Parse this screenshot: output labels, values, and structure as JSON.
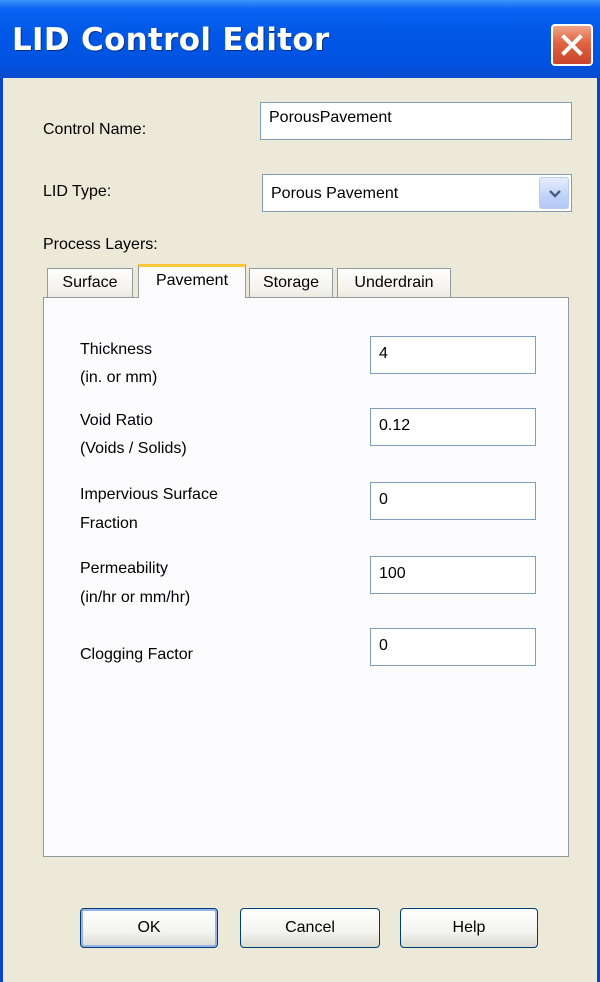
{
  "window": {
    "title": "LID Control Editor",
    "close_icon": "close-icon"
  },
  "control_name": {
    "label": "Control Name:",
    "value": "PorousPavement"
  },
  "lid_type": {
    "label": "LID Type:",
    "selected": "Porous Pavement",
    "dropdown_icon": "chevron-down-icon"
  },
  "process_layers": {
    "label": "Process Layers:",
    "tabs": [
      {
        "label": "Surface",
        "active": false
      },
      {
        "label": "Pavement",
        "active": true
      },
      {
        "label": "Storage",
        "active": false
      },
      {
        "label": "Underdrain",
        "active": false
      }
    ]
  },
  "pavement": {
    "fields": [
      {
        "label1": "Thickness",
        "label2": "(in. or mm)",
        "value": "4"
      },
      {
        "label1": "Void Ratio",
        "label2": "(Voids / Solids)",
        "value": "0.12"
      },
      {
        "label1": "Impervious Surface",
        "label2": "Fraction",
        "value": "0"
      },
      {
        "label1": "Permeability",
        "label2": "(in/hr or mm/hr)",
        "value": "100"
      },
      {
        "label1": "Clogging Factor",
        "label2": "",
        "value": "0"
      }
    ]
  },
  "buttons": {
    "ok": "OK",
    "cancel": "Cancel",
    "help": "Help"
  },
  "colors": {
    "titlebar": "#0053e1",
    "dialog_bg": "#ece9d8",
    "active_tab_accent": "#ffc83c",
    "close_button": "#e06442"
  }
}
